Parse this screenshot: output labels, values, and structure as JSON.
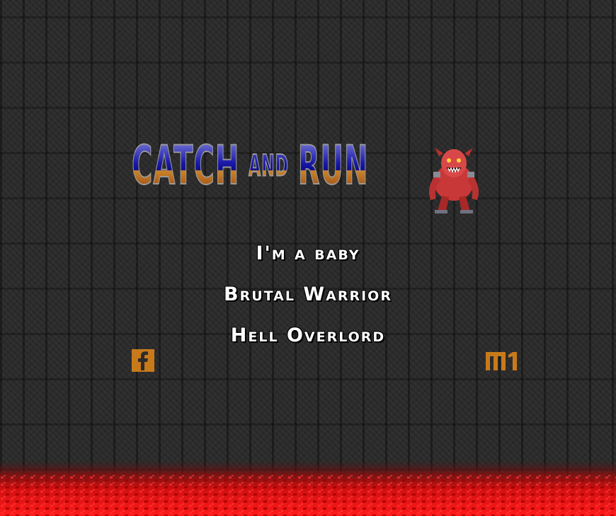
{
  "logo": {
    "title_word1": "CATCH",
    "title_word2": "AND",
    "title_word3": "RUN",
    "mascot_icon": "pinky-demon-icon"
  },
  "menu": {
    "items": [
      {
        "label": "I'm a baby"
      },
      {
        "label": "Brutal Warrior"
      },
      {
        "label": "Hell Overlord"
      }
    ]
  },
  "social": {
    "left_icon": "facebook-icon",
    "right_icon": "m1-icon"
  },
  "colors": {
    "background": "#2b2b2b",
    "logo_blue": "#1a1aa8",
    "logo_orange": "#c8842b",
    "menu_text": "#ffffff",
    "social_icon": "#c87a1a",
    "lava": "#d01010"
  }
}
